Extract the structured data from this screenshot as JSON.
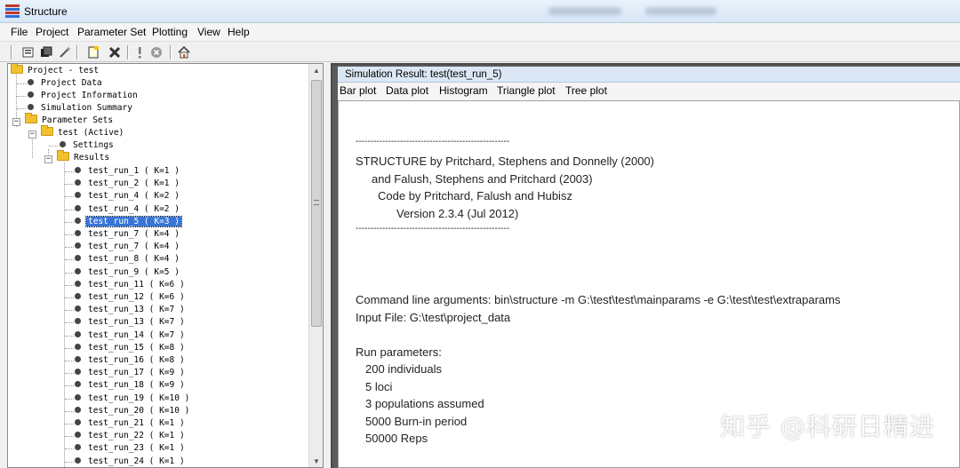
{
  "window": {
    "title": "Structure"
  },
  "menu": [
    "File",
    "Project",
    "Parameter Set",
    "Plotting",
    "View",
    "Help"
  ],
  "tree": {
    "project": "Project - test",
    "project_items": [
      "Project Data",
      "Project Information",
      "Simulation Summary"
    ],
    "parameter_sets": "Parameter Sets",
    "active_set": "test (Active)",
    "settings": "Settings",
    "results": "Results",
    "runs": [
      "test_run_1 ( K=1 )",
      "test_run_2 ( K=1 )",
      "test_run_4 ( K=2 )",
      "test_run_4 ( K=2 )",
      "test_run_5 ( K=3 )",
      "test_run_7 ( K=4 )",
      "test_run_7 ( K=4 )",
      "test_run_8 ( K=4 )",
      "test_run_9 ( K=5 )",
      "test_run_11 ( K=6 )",
      "test_run_12 ( K=6 )",
      "test_run_13 ( K=7 )",
      "test_run_13 ( K=7 )",
      "test_run_14 ( K=7 )",
      "test_run_15 ( K=8 )",
      "test_run_16 ( K=8 )",
      "test_run_17 ( K=9 )",
      "test_run_18 ( K=9 )",
      "test_run_19 ( K=10 )",
      "test_run_20 ( K=10 )",
      "test_run_21 ( K=1 )",
      "test_run_22 ( K=1 )",
      "test_run_23 ( K=1 )",
      "test_run_24 ( K=1 )"
    ],
    "selected_run_index": 4
  },
  "result": {
    "title": "Simulation Result: test(test_run_5)",
    "plot_menu": [
      "Bar plot",
      "Data plot",
      "Histogram",
      "Triangle plot",
      "Tree plot"
    ],
    "lines": [
      "----------------------------------------------------",
      "STRUCTURE by Pritchard, Stephens and Donnelly (2000)",
      "and Falush, Stephens and Pritchard (2003)",
      "Code by Pritchard, Falush and Hubisz",
      "Version 2.3.4 (Jul 2012)",
      "----------------------------------------------------",
      "Command line arguments:   bin\\structure -m G:\\test\\test\\mainparams -e G:\\test\\test\\extraparams",
      "Input File:    G:\\test\\project_data",
      "Run parameters:",
      "200 individuals",
      "5 loci",
      "3 populations assumed",
      "5000 Burn-in period",
      "50000 Reps"
    ]
  },
  "watermark": "知乎 @科研日精进",
  "colors": {
    "selection": "#3875d7",
    "folder": "#f2c12e",
    "frame": "#5a5a5a",
    "titlebar": "#d7e6f6"
  }
}
